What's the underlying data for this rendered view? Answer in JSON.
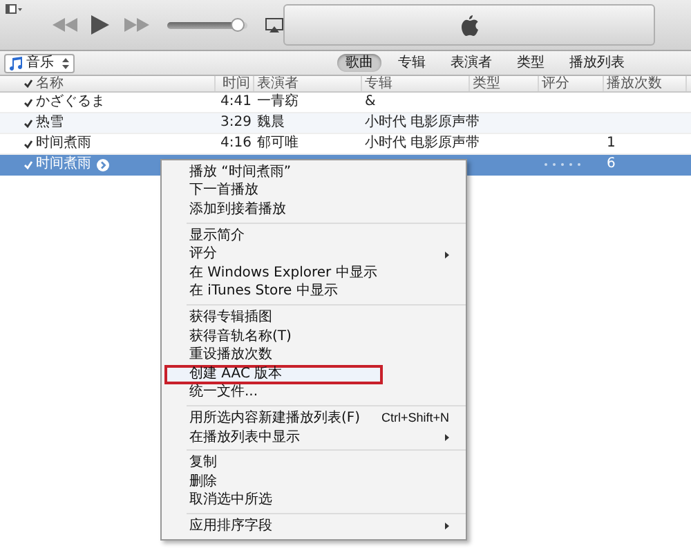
{
  "volume": {
    "level": 0.92
  },
  "library": {
    "label": "音乐"
  },
  "view_tabs": [
    {
      "label": "歌曲",
      "selected": true
    },
    {
      "label": "专辑",
      "selected": false
    },
    {
      "label": "表演者",
      "selected": false
    },
    {
      "label": "类型",
      "selected": false
    },
    {
      "label": "播放列表",
      "selected": false
    }
  ],
  "table": {
    "columns": [
      "名称",
      "时间",
      "表演者",
      "专辑",
      "类型",
      "评分",
      "播放次数"
    ],
    "rows": [
      {
        "checked": true,
        "selected": false,
        "name": "かざぐるま",
        "time": "4:41",
        "artist": "一青窈",
        "album": "&"
      },
      {
        "checked": true,
        "selected": false,
        "name": "热雪",
        "time": "3:29",
        "artist": "魏晨",
        "album": "小时代 电影原声带"
      },
      {
        "checked": true,
        "selected": false,
        "name": "时间煮雨",
        "time": "4:16",
        "artist": "郁可唯",
        "album": "小时代 电影原声带",
        "plays": "1"
      },
      {
        "checked": true,
        "selected": true,
        "name": "时间煮雨",
        "plays": "6"
      }
    ]
  },
  "context_menu": [
    {
      "kind": "item",
      "label": "播放 “时间煮雨”"
    },
    {
      "kind": "item",
      "label": "下一首播放"
    },
    {
      "kind": "item",
      "label": "添加到接着播放"
    },
    {
      "kind": "separator"
    },
    {
      "kind": "item",
      "label": "显示简介"
    },
    {
      "kind": "item",
      "label": "评分",
      "submenu": true
    },
    {
      "kind": "item",
      "label": "在 Windows Explorer 中显示"
    },
    {
      "kind": "item",
      "label": "在 iTunes Store 中显示"
    },
    {
      "kind": "separator"
    },
    {
      "kind": "item",
      "label": "获得专辑插图"
    },
    {
      "kind": "item",
      "label": "获得音轨名称(T)"
    },
    {
      "kind": "item",
      "label": "重设播放次数"
    },
    {
      "kind": "item",
      "label": "创建 AAC 版本",
      "highlighted": true
    },
    {
      "kind": "item",
      "label": "统一文件..."
    },
    {
      "kind": "separator"
    },
    {
      "kind": "item",
      "label": "用所选内容新建播放列表(F)",
      "shortcut": "Ctrl+Shift+N"
    },
    {
      "kind": "item",
      "label": "在播放列表中显示",
      "submenu": true
    },
    {
      "kind": "separator"
    },
    {
      "kind": "item",
      "label": "复制"
    },
    {
      "kind": "item",
      "label": "删除"
    },
    {
      "kind": "item",
      "label": "取消选中所选"
    },
    {
      "kind": "separator"
    },
    {
      "kind": "item",
      "label": "应用排序字段",
      "submenu": true
    }
  ]
}
